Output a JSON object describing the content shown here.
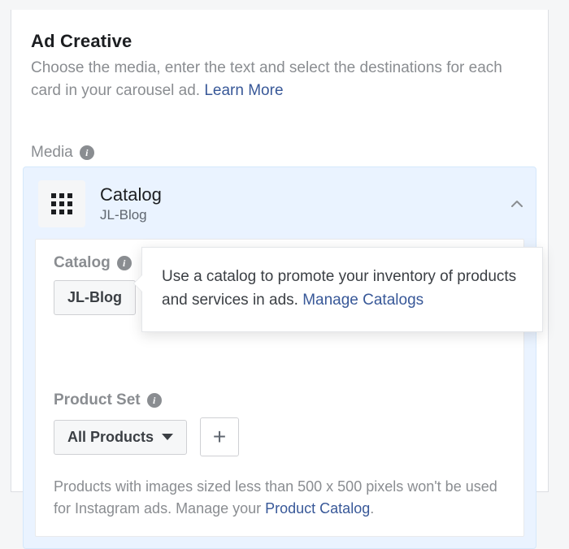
{
  "section": {
    "title": "Ad Creative",
    "subtitle_pre": "Choose the media, enter the text and select the destinations for each card in your carousel ad. ",
    "learn_more": "Learn More"
  },
  "media_label": "Media",
  "catalog_panel": {
    "title": "Catalog",
    "subtitle": "JL-Blog"
  },
  "catalog_section": {
    "label": "Catalog",
    "dropdown_value": "JL-Blog"
  },
  "tooltip": {
    "text_pre": "Use a catalog to promote your inventory of products and services in ads. ",
    "manage_link": "Manage Catalogs"
  },
  "product_set": {
    "label": "Product Set",
    "dropdown_value": "All Products"
  },
  "helper": {
    "pre": "Products with images sized less than 500 x 500 pixels won't be used for Instagram ads. Manage your ",
    "link": "Product Catalog",
    "post": "."
  }
}
